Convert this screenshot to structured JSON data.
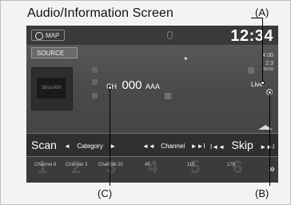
{
  "title": "Audio/Information Screen",
  "callouts": {
    "a": "(A)",
    "b": "(B)",
    "c": "(C)"
  },
  "screen": {
    "map_button": "MAP",
    "clock": "12:34",
    "source_button": "SOURCE",
    "right_info": {
      "line1": "4.00",
      "line2": "2:3",
      "line3": "00:00"
    },
    "album_art_text": "SiriusXM",
    "channel": {
      "prefix": "CH",
      "number": "000",
      "name": "AAA"
    },
    "live_label": "Live",
    "controls": {
      "scan": "Scan",
      "category_left_icon": "◄",
      "category": "Category",
      "category_right_icon": "►",
      "channel_left_icon": "◄◄",
      "channel": "Channel",
      "channel_right_icon": "►►I",
      "skip_left_icon": "I◄◄",
      "skip": "Skip",
      "skip_right_icon": "►►I"
    },
    "presets": [
      {
        "label": "Channel 8",
        "bg": "1"
      },
      {
        "label": "Channel 3",
        "bg": "2"
      },
      {
        "label": "Channel 20",
        "bg": "3"
      },
      {
        "label": "49",
        "bg": "4"
      },
      {
        "label": "115",
        "bg": "5"
      },
      {
        "label": "176",
        "bg": "6"
      }
    ],
    "more_icon": "»"
  }
}
